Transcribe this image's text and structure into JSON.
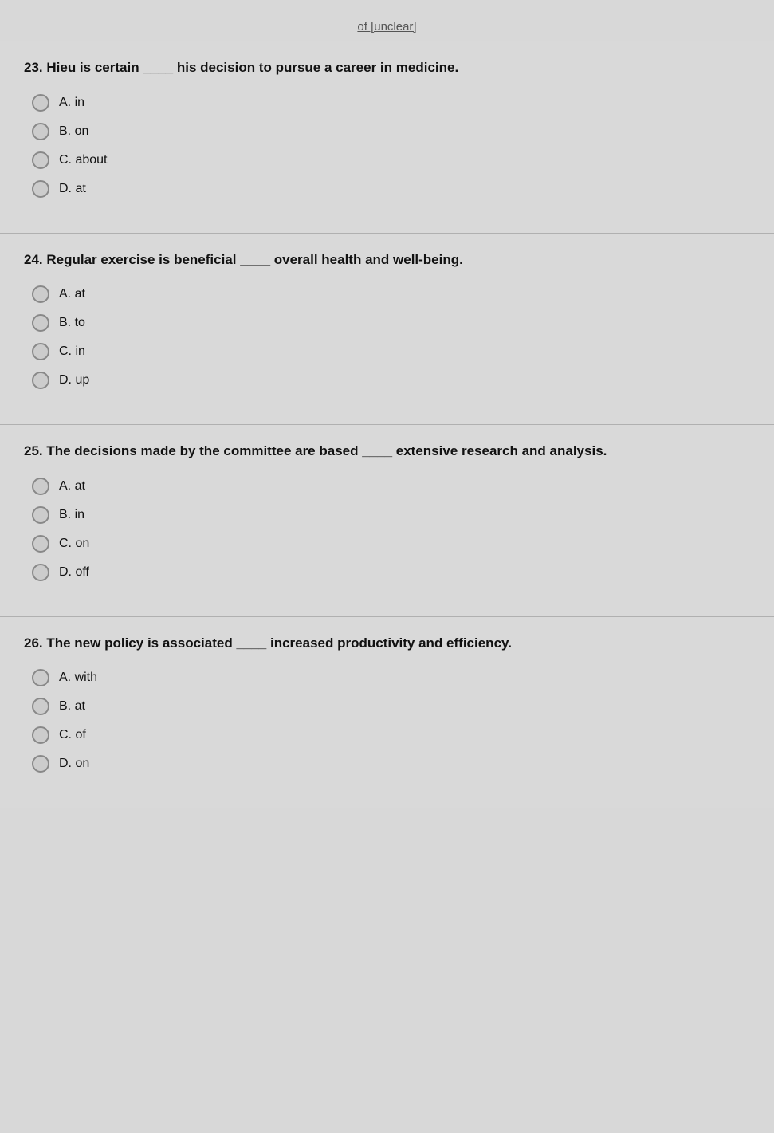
{
  "questions": [
    {
      "number": "23",
      "text": "Hieu is certain ____ his decision to pursue a career in medicine.",
      "options": [
        {
          "letter": "A",
          "value": "in"
        },
        {
          "letter": "B",
          "value": "on"
        },
        {
          "letter": "C",
          "value": "about"
        },
        {
          "letter": "D",
          "value": "at"
        }
      ]
    },
    {
      "number": "24",
      "text": "Regular exercise is beneficial ____ overall health and well-being.",
      "options": [
        {
          "letter": "A",
          "value": "at"
        },
        {
          "letter": "B",
          "value": "to"
        },
        {
          "letter": "C",
          "value": "in"
        },
        {
          "letter": "D",
          "value": "up"
        }
      ]
    },
    {
      "number": "25",
      "text": "The decisions made by the committee are based ____ extensive research and analysis.",
      "options": [
        {
          "letter": "A",
          "value": "at"
        },
        {
          "letter": "B",
          "value": "in"
        },
        {
          "letter": "C",
          "value": "on"
        },
        {
          "letter": "D",
          "value": "off"
        }
      ]
    },
    {
      "number": "26",
      "text": "The new policy is associated ____ increased productivity and efficiency.",
      "options": [
        {
          "letter": "A",
          "value": "with"
        },
        {
          "letter": "B",
          "value": "at"
        },
        {
          "letter": "C",
          "value": "of"
        },
        {
          "letter": "D",
          "value": "on"
        }
      ]
    }
  ]
}
